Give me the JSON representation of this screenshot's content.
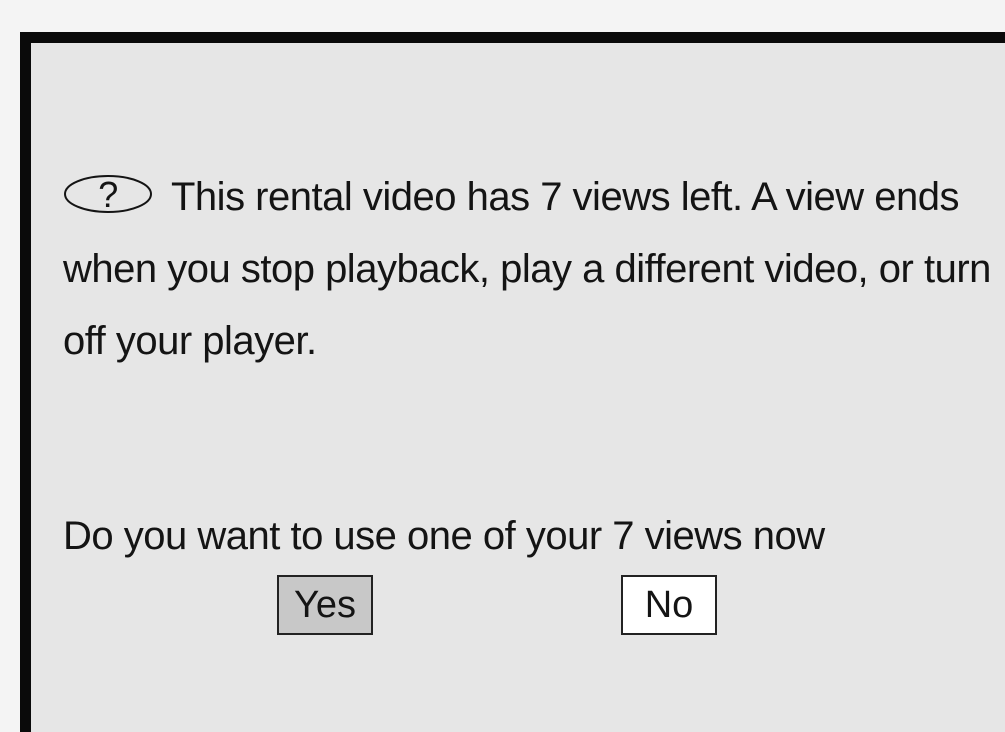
{
  "dialog": {
    "icon": "question-mark-icon",
    "icon_glyph": "?",
    "message": "This rental video has 7 views left. A view ends when you stop playback, play a different video, or turn off your player.",
    "question": "Do you want to use one of your 7 views now",
    "yes_label": "Yes",
    "no_label": "No",
    "selected_button": "Yes"
  },
  "colors": {
    "dialog_background": "#e6e6e6",
    "frame": "#0a0a0a",
    "selected_button": "#c8c8c8",
    "unselected_button": "#ffffff"
  }
}
